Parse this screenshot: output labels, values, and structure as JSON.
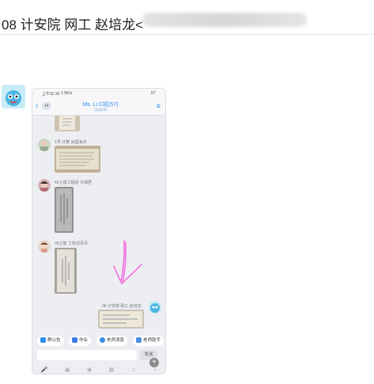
{
  "header": {
    "title": "08 计安院 网工 赵培龙<"
  },
  "phone": {
    "status_bar": {
      "time": "上午11:16",
      "speed": "1.5K/s",
      "battery": "57"
    },
    "nav": {
      "back": "‹",
      "unread": "14",
      "title": "Ms. Li C班(57)",
      "subtitle": "班级群聊",
      "menu": "≡"
    },
    "messages": [
      {
        "name": "1号 计算 尚国海洋"
      },
      {
        "name": "40土建工程班 许瑞君"
      },
      {
        "name": "39土建 工管邓丹丹"
      },
      {
        "name": "08 计安院 网工 赵培龙"
      }
    ],
    "quick_actions": [
      {
        "label": "群公告",
        "color": "#2d8ff0"
      },
      {
        "label": "作业",
        "color": "#3b7be8"
      },
      {
        "label": "老师消息",
        "color": "#3a8fe8"
      },
      {
        "label": "老师助手",
        "color": "#4a90e2"
      }
    ],
    "input": {
      "placeholder": "",
      "send_label": "发送"
    },
    "toolbar": [
      "🎤",
      "▣",
      "◉",
      "▦",
      "☺",
      "+"
    ]
  }
}
